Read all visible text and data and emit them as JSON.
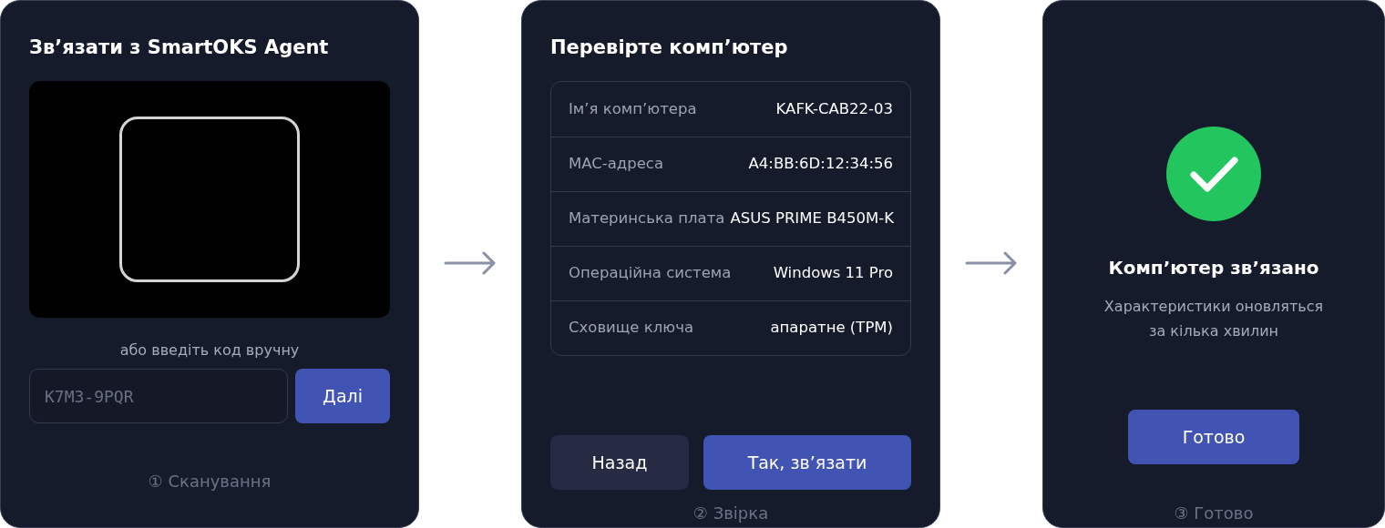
{
  "steps": [
    {
      "kind": "scan",
      "title": "Зв’язати з SmartOKS Agent",
      "hint": "або введіть код вручну",
      "code_field": {
        "placeholder": "K7M3-9PQR"
      },
      "button": "Далі",
      "step_label": "① Сканування"
    },
    {
      "kind": "verify",
      "title": "Перевірте комп’ютер",
      "rows": [
        {
          "label": "Ім’я комп’ютера",
          "value": "KAFK-CAB22-03"
        },
        {
          "label": "MAC-адреса",
          "value": "A4:BB:6D:12:34:56"
        },
        {
          "label": "Материнська плата",
          "value": "ASUS PRIME B450M-K"
        },
        {
          "label": "Операційна система",
          "value": "Windows 11 Pro"
        },
        {
          "label": "Сховище ключа",
          "value": "апаратне (TPM)"
        }
      ],
      "buttons": [
        {
          "label": "Назад",
          "kind": "secondary"
        },
        {
          "label": "Так, зв’язати",
          "kind": "primary"
        }
      ],
      "step_label": "② Звірка"
    },
    {
      "kind": "done",
      "title": "Комп’ютер зв’язано",
      "lines": [
        "Характеристики оновляться",
        "за кілька хвилин"
      ],
      "button": "Готово",
      "step_label": "③ Готово"
    }
  ]
}
